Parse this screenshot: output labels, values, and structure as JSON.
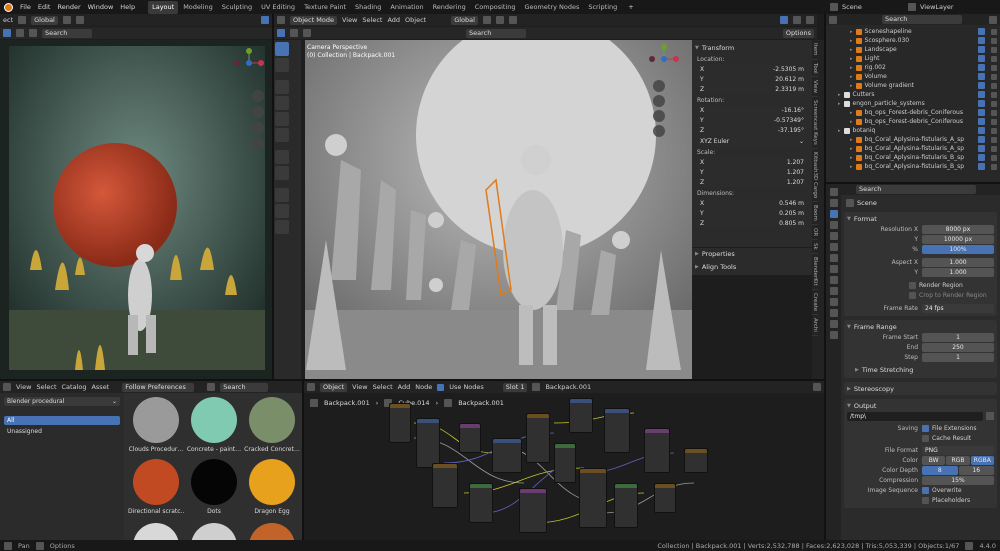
{
  "top_menu": {
    "file": "File",
    "edit": "Edit",
    "render": "Render",
    "window": "Window",
    "help": "Help",
    "workspaces": [
      "Layout",
      "Modeling",
      "Sculpting",
      "UV Editing",
      "Texture Paint",
      "Shading",
      "Animation",
      "Rendering",
      "Compositing",
      "Geometry Nodes",
      "Scripting"
    ],
    "active_workspace": "Layout",
    "plus": "+",
    "scene_name": "Scene",
    "view_layer": "ViewLayer"
  },
  "left_viewport": {
    "header_select": "ect",
    "orientation": "Global",
    "search_placeholder": "Search"
  },
  "main_viewport": {
    "mode": "Object Mode",
    "menu": [
      "View",
      "Select",
      "Add",
      "Object"
    ],
    "orientation": "Global",
    "options": "Options",
    "search_placeholder": "Search",
    "overlay_title": "Camera Perspective",
    "overlay_subtitle": "(0) Collection | Backpack.001"
  },
  "npanel": {
    "tabs": [
      "Item",
      "Tool",
      "View",
      "Screencast Keys",
      "Kitbash3D Cargo",
      "Boom",
      "OR",
      "Sk",
      "BlenderKit",
      "Create",
      "Archi"
    ],
    "transform_title": "Transform",
    "location_label": "Location:",
    "location": [
      {
        "axis": "X",
        "value": "-2.5305 m"
      },
      {
        "axis": "Y",
        "value": "20.612 m"
      },
      {
        "axis": "Z",
        "value": "2.3319 m"
      }
    ],
    "rotation_label": "Rotation:",
    "rotation": [
      {
        "axis": "X",
        "value": "-16.16°"
      },
      {
        "axis": "Y",
        "value": "-0.57349°"
      },
      {
        "axis": "Z",
        "value": "-37.195°"
      }
    ],
    "rotation_mode": "XYZ Euler",
    "scale_label": "Scale:",
    "scale": [
      {
        "axis": "X",
        "value": "1.207"
      },
      {
        "axis": "Y",
        "value": "1.207"
      },
      {
        "axis": "Z",
        "value": "1.207"
      }
    ],
    "dimensions_label": "Dimensions:",
    "dimensions": [
      {
        "axis": "X",
        "value": "0.546 m"
      },
      {
        "axis": "Y",
        "value": "0.205 m"
      },
      {
        "axis": "Z",
        "value": "0.805 m"
      }
    ],
    "properties": "Properties",
    "align_tools": "Align Tools"
  },
  "outliner": {
    "search_placeholder": "Search",
    "rows": [
      {
        "name": "Sceneshapeline",
        "indent": 2
      },
      {
        "name": "Scosphere.030",
        "indent": 2
      },
      {
        "name": "Landscape",
        "indent": 2
      },
      {
        "name": "Light",
        "indent": 2
      },
      {
        "name": "rig.002",
        "indent": 2
      },
      {
        "name": "Volume",
        "indent": 2
      },
      {
        "name": "Volume gradient",
        "indent": 2
      },
      {
        "name": "Cutters",
        "indent": 1
      },
      {
        "name": "engon_particle_systems",
        "indent": 1
      },
      {
        "name": "bq_ops_Forest-debris_Coniferous",
        "indent": 2
      },
      {
        "name": "bq_ops_Forest-debris_Coniferous",
        "indent": 2
      },
      {
        "name": "botaniq",
        "indent": 1
      },
      {
        "name": "bq_Coral_Aplysina-fistularis_A_sp",
        "indent": 2
      },
      {
        "name": "bq_Coral_Aplysina-fistularis_A_sp",
        "indent": 2
      },
      {
        "name": "bq_Coral_Aplysina-fistularis_B_sp",
        "indent": 2
      },
      {
        "name": "bq_Coral_Aplysina-fistularis_B_sp",
        "indent": 2
      }
    ]
  },
  "properties": {
    "search_placeholder": "Search",
    "scene_name": "Scene",
    "format_title": "Format",
    "resolution_x_label": "Resolution X",
    "resolution_x": "8000 px",
    "resolution_y_label": "Y",
    "resolution_y": "10000 px",
    "resolution_pct_label": "%",
    "resolution_pct": "100%",
    "aspect_x_label": "Aspect X",
    "aspect_x": "1.000",
    "aspect_y_label": "Y",
    "aspect_y": "1.000",
    "render_region": "Render Region",
    "crop_region": "Crop to Render Region",
    "frame_rate_label": "Frame Rate",
    "frame_rate": "24 fps",
    "frame_range_title": "Frame Range",
    "frame_start_label": "Frame Start",
    "frame_start": "1",
    "end_label": "End",
    "end": "250",
    "step_label": "Step",
    "step": "1",
    "time_stretching": "Time Stretching",
    "stereoscopy": "Stereoscopy",
    "output_title": "Output",
    "output_path": "/tmp\\",
    "saving_label": "Saving",
    "file_extensions": "File Extensions",
    "cache_result": "Cache Result",
    "file_format_label": "File Format",
    "file_format": "PNG",
    "color_label": "Color",
    "color_options": [
      "BW",
      "RGB",
      "RGBA"
    ],
    "color_selected": "RGBA",
    "color_depth_label": "Color Depth",
    "color_depth_options": [
      "8",
      "16"
    ],
    "color_depth_selected": "8",
    "compression_label": "Compression",
    "compression": "15%",
    "image_sequence_label": "Image Sequence",
    "overwrite": "Overwrite",
    "placeholders": "Placeholders"
  },
  "asset_browser": {
    "menu": [
      "View",
      "Select",
      "Catalog",
      "Asset"
    ],
    "import_method": "Follow Preferences",
    "library": "Blender procedural",
    "search_placeholder": "Search",
    "catalogs": [
      "All",
      "Unassigned"
    ],
    "assets": [
      {
        "name": "Clouds Procedur…",
        "color": "#9a9a9a"
      },
      {
        "name": "Concrete - paint…",
        "color": "#7fcab0"
      },
      {
        "name": "Cracked Concret…",
        "color": "#7a8e6a"
      },
      {
        "name": "Directional scratc…",
        "color": "#c24a22"
      },
      {
        "name": "Dots",
        "color": "#050505"
      },
      {
        "name": "Dragon Egg",
        "color": "#e8a11c"
      }
    ]
  },
  "node_editor": {
    "object_type": "Object",
    "menu": [
      "View",
      "Select",
      "Add",
      "Node"
    ],
    "use_nodes": "Use Nodes",
    "slot": "Slot 1",
    "material": "Backpack.001",
    "breadcrumb": [
      "Backpack.001",
      "Cube.014",
      "Backpack.001"
    ]
  },
  "status_bar": {
    "pan": "Pan",
    "options": "Options",
    "stats": "Collection | Backpack.001 | Verts:2,532,788 | Faces:2,623,028 | Tris:5,053,339 | Objects:1/67",
    "version": "4.4.0"
  },
  "colors": {
    "accent": "#4772b3",
    "orange": "#e07b1a",
    "panel": "#2b2b2b",
    "header": "#232323"
  }
}
